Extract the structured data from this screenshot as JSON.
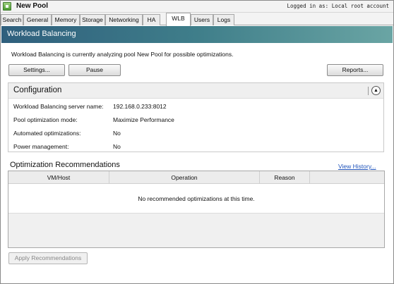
{
  "window": {
    "title": "New Pool",
    "login_status": "Logged in as: Local root account"
  },
  "tabs": [
    {
      "label": "Search"
    },
    {
      "label": "General"
    },
    {
      "label": "Memory"
    },
    {
      "label": "Storage"
    },
    {
      "label": "Networking"
    },
    {
      "label": "HA"
    },
    {
      "label": "WLB",
      "active": true
    },
    {
      "label": "Users"
    },
    {
      "label": "Logs"
    }
  ],
  "header": {
    "title": "Workload Balancing"
  },
  "status_message": "Workload Balancing is currently analyzing pool New Pool for possible optimizations.",
  "buttons": {
    "settings": "Settings...",
    "pause": "Pause",
    "reports": "Reports...",
    "apply": "Apply Recommendations"
  },
  "configuration": {
    "title": "Configuration",
    "collapse_icon": "chevron-up-icon",
    "rows": [
      {
        "label": "Workload Balancing server name:",
        "value": "192.168.0.233:8012"
      },
      {
        "label": "Pool optimization mode:",
        "value": "Maximize Performance"
      },
      {
        "label": "Automated optimizations:",
        "value": "No"
      },
      {
        "label": "Power management:",
        "value": "No"
      }
    ]
  },
  "recommendations": {
    "title": "Optimization Recommendations",
    "history_link": "View History...",
    "columns": [
      "VM/Host",
      "Operation",
      "Reason"
    ],
    "empty_message": "No recommended optimizations at this time."
  },
  "colors": {
    "header_gradient_start": "#2f5f7d",
    "header_gradient_end": "#6aa5a4",
    "link": "#2255bb"
  }
}
